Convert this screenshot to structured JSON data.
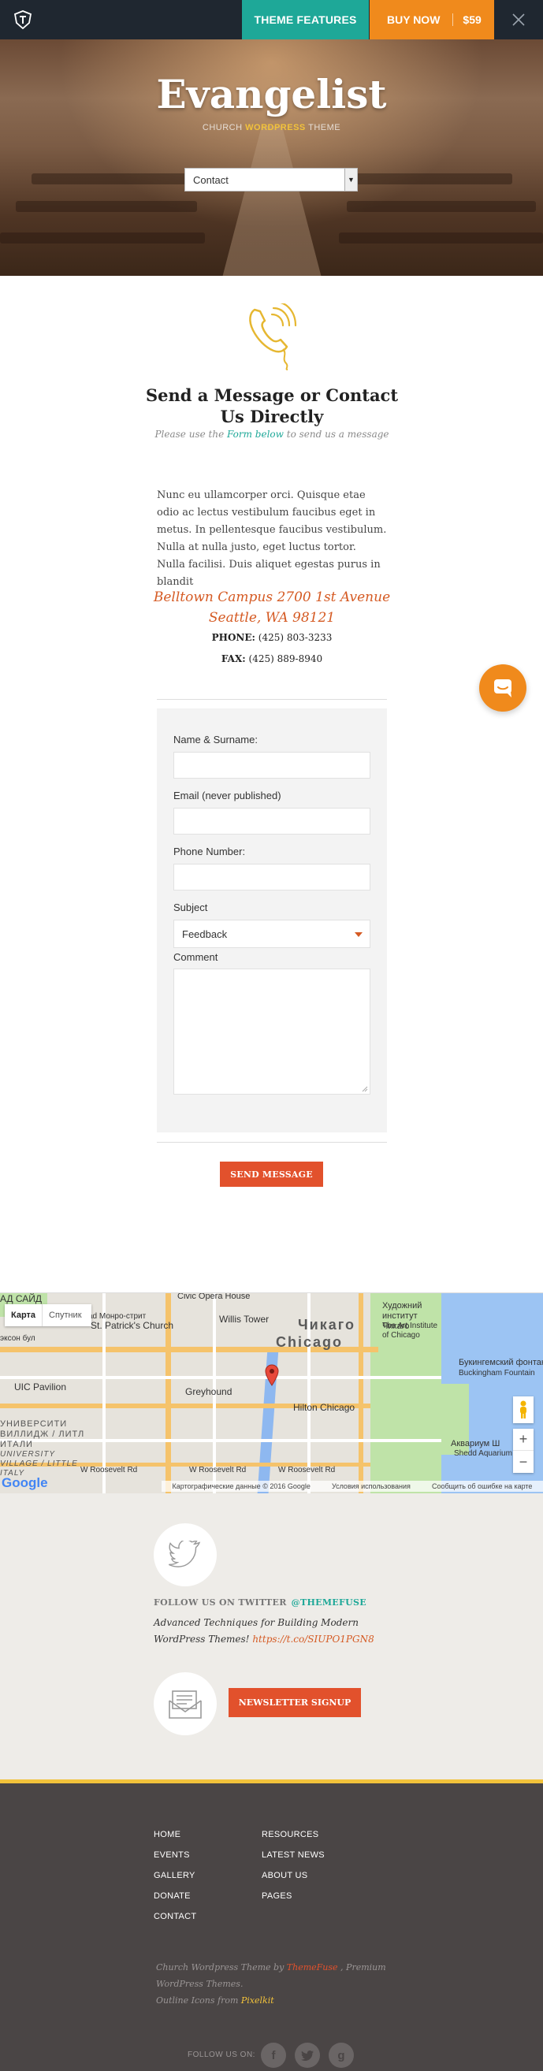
{
  "topbar": {
    "features_label": "THEME FEATURES",
    "buy_label": "BUY NOW",
    "price": "$59"
  },
  "hero": {
    "title": "Evangelist",
    "subtitle_pre": "CHURCH ",
    "subtitle_wp": "WORDPRESS",
    "subtitle_post": " THEME",
    "select_value": "Contact"
  },
  "contact": {
    "title_line1": "Send a Message or Contact",
    "title_line2": "Us Directly",
    "sub_pre": "Please use the ",
    "sub_link": "Form below",
    "sub_post": " to send us a message",
    "paragraph": "Nunc eu ullamcorper orci. Quisque etae odio ac lectus vestibulum faucibus eget in metus. In pellentesque faucibus vestibulum. Nulla at nulla justo, eget luctus tortor. Nulla facilisi. Duis aliquet egestas purus in blandit",
    "address_line1": "Belltown Campus 2700 1st Avenue",
    "address_line2": "Seattle, WA 98121",
    "phone_label": "PHONE:",
    "phone": "(425) 803-3233",
    "fax_label": "FAX:",
    "fax": "(425) 889-8940"
  },
  "form": {
    "name_label": "Name & Surname:",
    "email_label": "Email (never published)",
    "phone_label": "Phone Number:",
    "subject_label": "Subject",
    "subject_value": "Feedback",
    "comment_label": "Comment",
    "send_label": "SEND MESSAGE"
  },
  "map": {
    "toggle_map": "Карта",
    "toggle_sat": "Спутник",
    "labels": {
      "chicago_ru": "Чикаго",
      "chicago_en": "Chicago",
      "willis": "Willis Tower",
      "patrick": "St. Patrick's Church",
      "greyhound": "Greyhound",
      "uic": "UIC Pavilion",
      "hilton": "Hilton Chicago",
      "art": "Художний институт Чикаго",
      "art_en": "The Art Institute of Chicago",
      "buckingham_ru": "Букингемский фонтан",
      "buckingham_en": "Buckingham Fountain",
      "aquarium": "Аквариум Ш",
      "shedd": "Shedd Aquarium",
      "opera": "Civic Opera House",
      "roosevelt": "W Roosevelt Rd",
      "university": "UNIVERSITY VILLAGE / LITTLE ITALY",
      "university_ru": "УНИВЕРСИТИ ВИЛЛИДЖ / ЛИТЛ ИТАЛИ",
      "said": "АД САЙД",
      "harrison": "ad Монро-стрит",
      "eisenhower": "эксон бул"
    },
    "footer_data": "Картографические данные © 2016 Google",
    "footer_terms": "Условия использования",
    "footer_report": "Сообщить об ошибке на карте",
    "google": "Google"
  },
  "social": {
    "follow_label": "FOLLOW US ON TWITTER",
    "handle": "@THEMEFUSE",
    "tweet_text": "Advanced Techniques for Building Modern WordPress Themes! ",
    "tweet_link": "https://t.co/SIUPO1PGN8",
    "newsletter_label": "NEWSLETTER SIGNUP"
  },
  "footer": {
    "col1": [
      "HOME",
      "EVENTS",
      "GALLERY",
      "DONATE",
      "CONTACT"
    ],
    "col2": [
      "RESOURCES",
      "LATEST NEWS",
      "ABOUT US",
      "PAGES"
    ],
    "credit_pre": "Church Wordpress Theme by ",
    "credit_brand": "ThemeFuse",
    "credit_mid": " , Premium WordPress Themes.",
    "credit_icons_pre": "Outline Icons from ",
    "credit_icons_brand": "Pixelkit",
    "follow_us": "FOLLOW US ON:",
    "social_icons": [
      "facebook-icon",
      "twitter-icon",
      "google-plus-icon"
    ]
  },
  "colors": {
    "teal": "#1ea898",
    "orange": "#f08a1c",
    "red": "#e2512c",
    "yellow": "#f2c23b"
  }
}
